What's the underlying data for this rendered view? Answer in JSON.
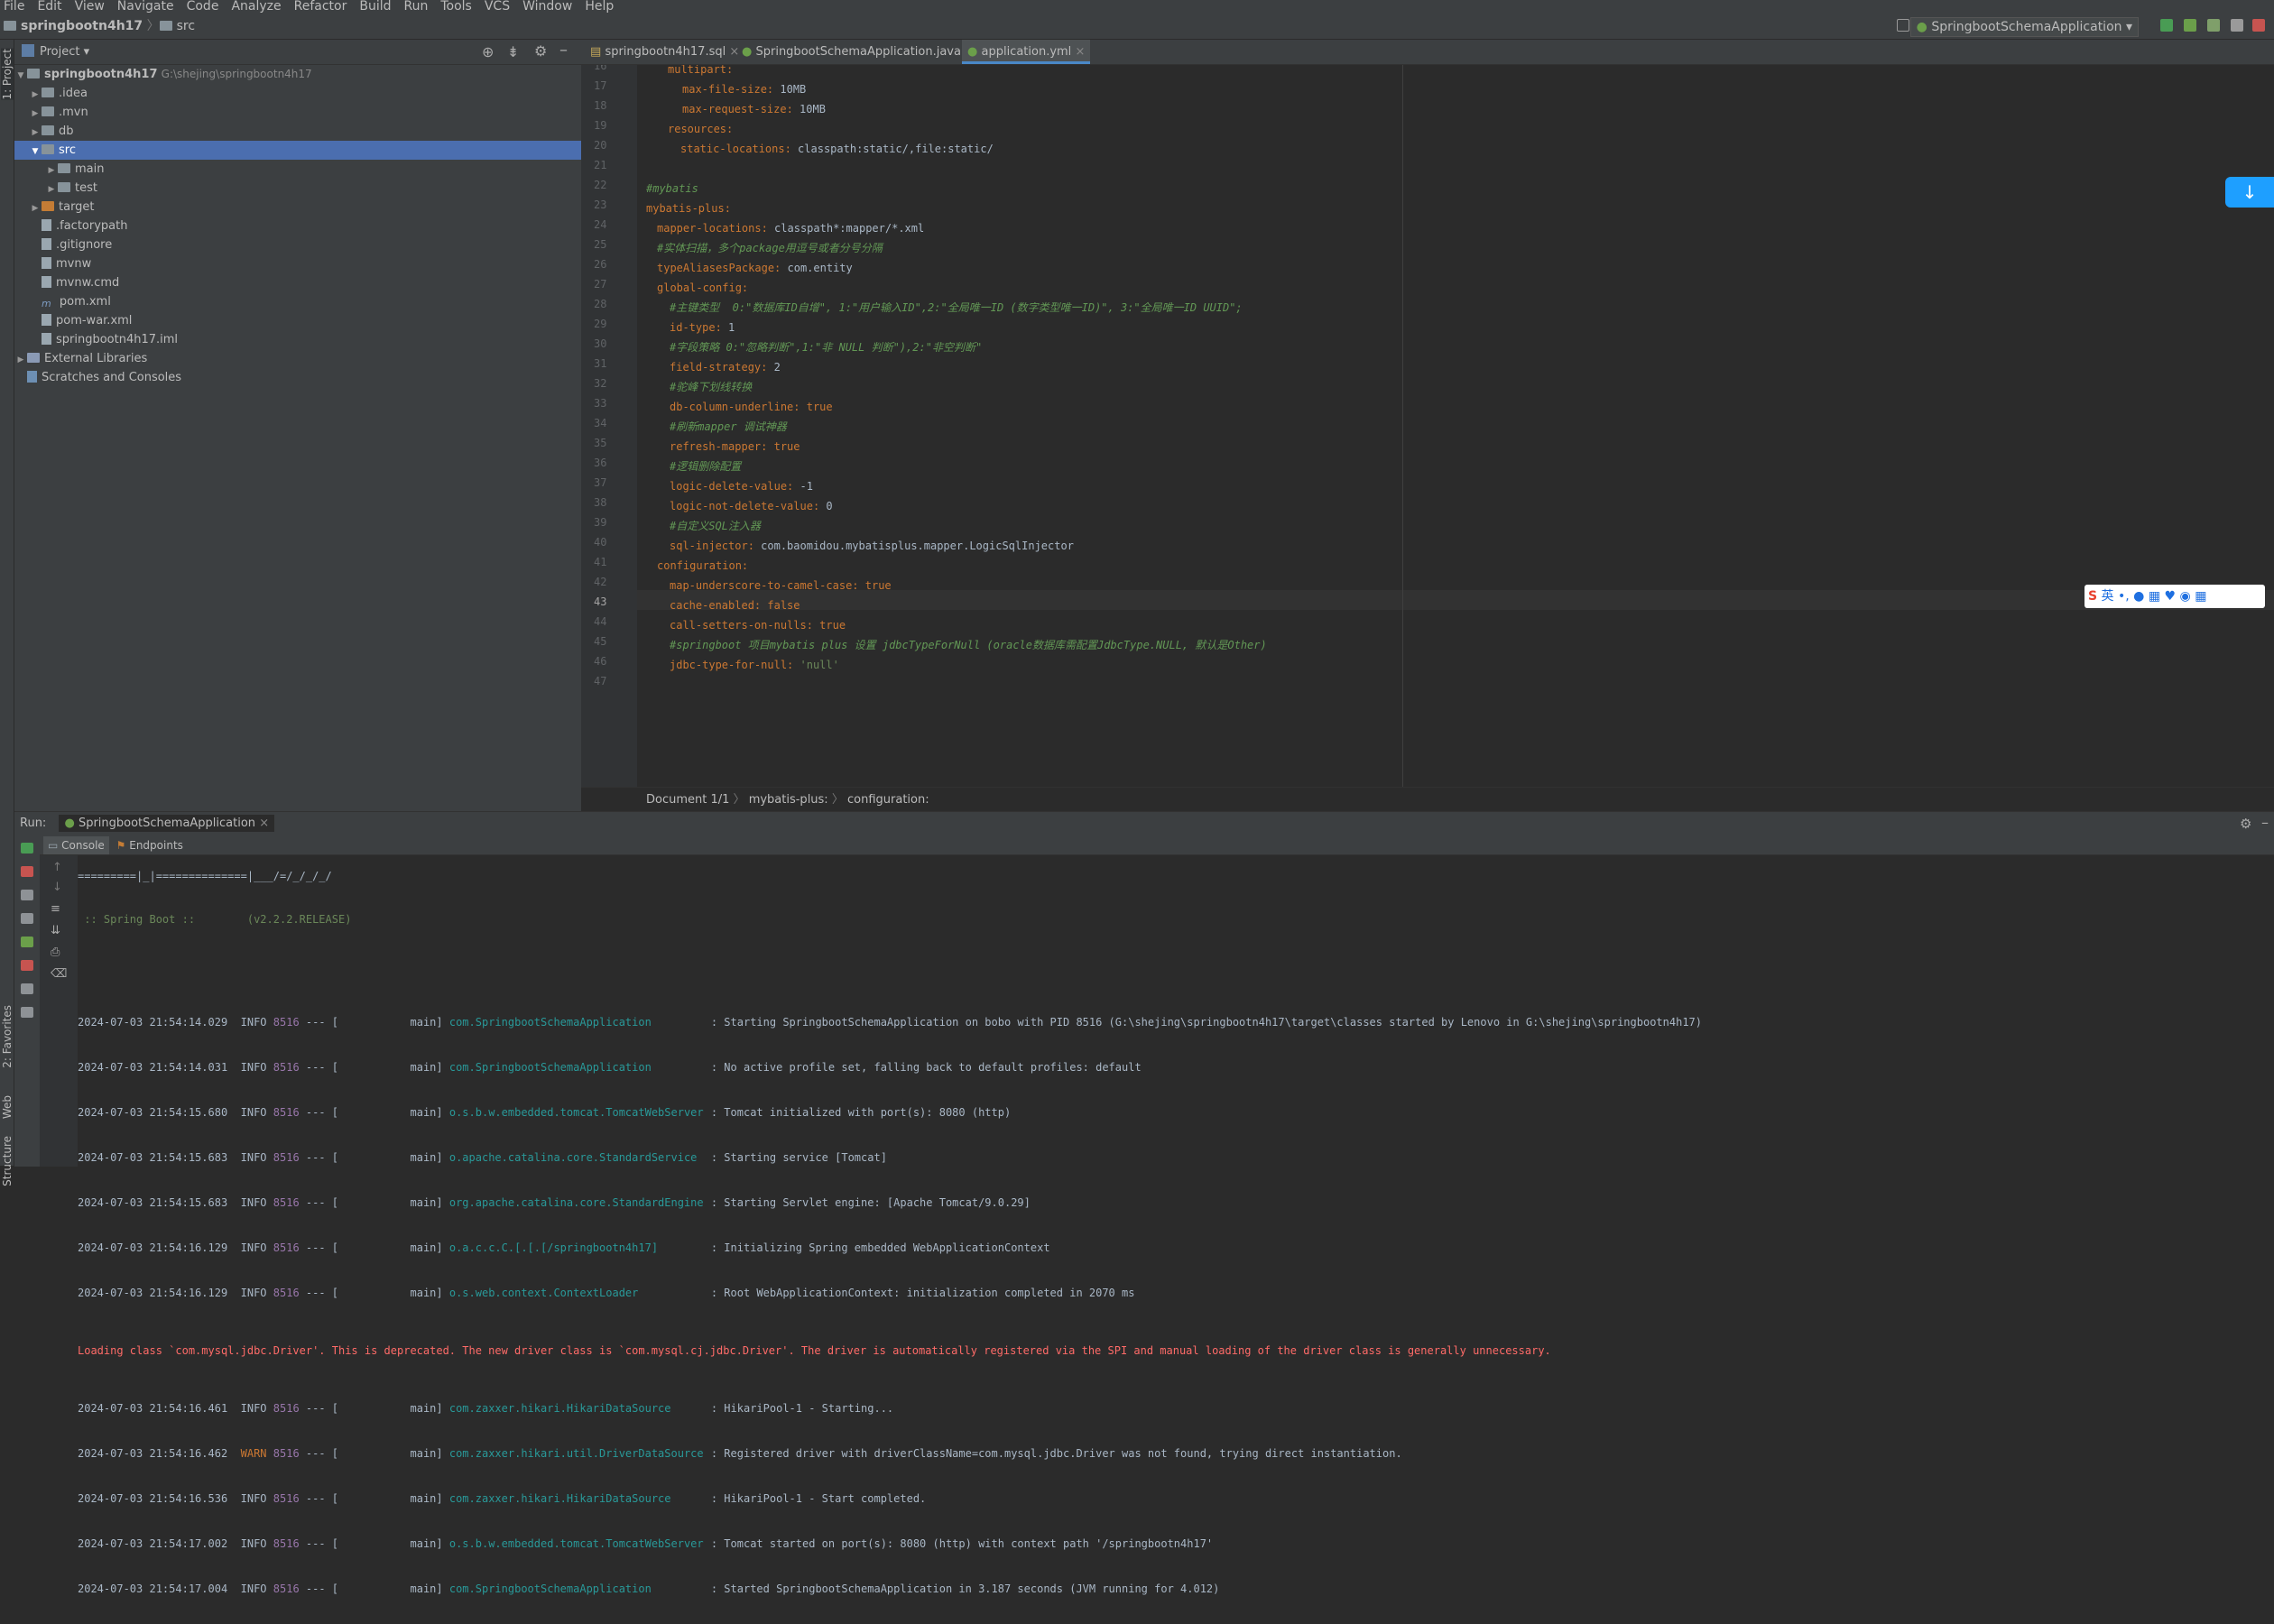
{
  "menubar": [
    "File",
    "Edit",
    "View",
    "Navigate",
    "Code",
    "Analyze",
    "Refactor",
    "Build",
    "Run",
    "Tools",
    "VCS",
    "Window",
    "Help"
  ],
  "breadcrumb": {
    "project": "springbootn4h17",
    "folder": "src"
  },
  "run_config": "SpringbootSchemaApplication",
  "left_tabs": {
    "project": "1: Project",
    "favorites": "2: Favorites",
    "web": "Web",
    "structure": "Structure"
  },
  "project_panel": {
    "title": "Project",
    "root": {
      "name": "springbootn4h17",
      "path": "G:\\shejing\\springbootn4h17"
    },
    "items": [
      ".idea",
      ".mvn",
      "db",
      "src",
      "main",
      "test",
      "target",
      ".factorypath",
      ".gitignore",
      "mvnw",
      "mvnw.cmd",
      "pom.xml",
      "pom-war.xml",
      "springbootn4h17.iml",
      "External Libraries",
      "Scratches and Consoles"
    ],
    "pom_prefix": "m"
  },
  "editor_tabs": [
    "springbootn4h17.sql",
    "SpringbootSchemaApplication.java",
    "application.yml"
  ],
  "code_lines": {
    "l16": {
      "n": "16",
      "k": "multipart:"
    },
    "l17": {
      "n": "17",
      "k": "max-file-size:",
      "v": " 10MB"
    },
    "l18": {
      "n": "18",
      "k": "max-request-size:",
      "v": " 10MB"
    },
    "l19": {
      "n": "19",
      "k": "resources:"
    },
    "l20": {
      "n": "20",
      "k": "static-locations:",
      "v": " classpath:static/,file:static/"
    },
    "l21": {
      "n": "21"
    },
    "l22": {
      "n": "22",
      "c": "#mybatis"
    },
    "l23": {
      "n": "23",
      "k": "mybatis-plus:"
    },
    "l24": {
      "n": "24",
      "k": "mapper-locations:",
      "v": " classpath*:mapper/*.xml"
    },
    "l25": {
      "n": "25",
      "c": "#实体扫描，多个package用逗号或者分号分隔"
    },
    "l26": {
      "n": "26",
      "k": "typeAliasesPackage:",
      "v": " com.entity"
    },
    "l27": {
      "n": "27",
      "k": "global-config:"
    },
    "l28": {
      "n": "28",
      "c": "#主键类型  0:\"数据库ID自增\", 1:\"用户输入ID\",2:\"全局唯一ID (数字类型唯一ID)\", 3:\"全局唯一ID UUID\";"
    },
    "l29": {
      "n": "29",
      "k": "id-type:",
      "v": " 1"
    },
    "l30": {
      "n": "30",
      "c": "#字段策略 0:\"忽略判断\",1:\"非 NULL 判断\"),2:\"非空判断\""
    },
    "l31": {
      "n": "31",
      "k": "field-strategy:",
      "v": " 2"
    },
    "l32": {
      "n": "32",
      "c": "#驼峰下划线转换"
    },
    "l33": {
      "n": "33",
      "k": "db-column-underline:",
      "v": " true",
      "vk": true
    },
    "l34": {
      "n": "34",
      "c": "#刷新mapper 调试神器"
    },
    "l35": {
      "n": "35",
      "k": "refresh-mapper:",
      "v": " true",
      "vk": true
    },
    "l36": {
      "n": "36",
      "c": "#逻辑删除配置"
    },
    "l37": {
      "n": "37",
      "k": "logic-delete-value:",
      "v": " -1"
    },
    "l38": {
      "n": "38",
      "k": "logic-not-delete-value:",
      "v": " 0"
    },
    "l39": {
      "n": "39",
      "c": "#自定义SQL注入器"
    },
    "l40": {
      "n": "40",
      "k": "sql-injector:",
      "v": " com.baomidou.mybatisplus.mapper.LogicSqlInjector"
    },
    "l41": {
      "n": "41",
      "k": "configuration:"
    },
    "l42": {
      "n": "42",
      "k": "map-underscore-to-camel-case:",
      "v": " true",
      "vk": true
    },
    "l43": {
      "n": "43",
      "k": "cache-enabled:",
      "v": " false",
      "vk": true
    },
    "l44": {
      "n": "44",
      "k": "call-setters-on-nulls:",
      "v": " true",
      "vk": true
    },
    "l45": {
      "n": "45",
      "c": "#springboot 项目mybatis plus 设置 jdbcTypeForNull (oracle数据库需配置JdbcType.NULL, 默认是Other)"
    },
    "l46": {
      "n": "46",
      "k": "jdbc-type-for-null:",
      "s": " 'null'"
    },
    "l47": {
      "n": "47"
    }
  },
  "editor_breadcrumb": {
    "doc": "Document 1/1",
    "a": "mybatis-plus:",
    "b": "configuration:"
  },
  "run_panel": {
    "label": "Run:",
    "tab": "SpringbootSchemaApplication",
    "console_tab": "Console",
    "endpoints_tab": "Endpoints"
  },
  "console": {
    "banner1": "=========|_|==============|___/=/_/_/_/",
    "banner2": " :: Spring Boot ::        (v2.2.2.RELEASE)",
    "rows": [
      {
        "ts": "2024-07-03 21:54:14.029",
        "lvl": "INFO",
        "pid": "8516",
        "th": "--- [           main]",
        "cls": "com.SpringbootSchemaApplication",
        "msg": ": Starting SpringbootSchemaApplication on bobo with PID 8516 (G:\\shejing\\springbootn4h17\\target\\classes started by Lenovo in G:\\shejing\\springbootn4h17)"
      },
      {
        "ts": "2024-07-03 21:54:14.031",
        "lvl": "INFO",
        "pid": "8516",
        "th": "--- [           main]",
        "cls": "com.SpringbootSchemaApplication",
        "msg": ": No active profile set, falling back to default profiles: default"
      },
      {
        "ts": "2024-07-03 21:54:15.680",
        "lvl": "INFO",
        "pid": "8516",
        "th": "--- [           main]",
        "cls": "o.s.b.w.embedded.tomcat.TomcatWebServer",
        "msg": ": Tomcat initialized with port(s): 8080 (http)"
      },
      {
        "ts": "2024-07-03 21:54:15.683",
        "lvl": "INFO",
        "pid": "8516",
        "th": "--- [           main]",
        "cls": "o.apache.catalina.core.StandardService",
        "msg": ": Starting service [Tomcat]"
      },
      {
        "ts": "2024-07-03 21:54:15.683",
        "lvl": "INFO",
        "pid": "8516",
        "th": "--- [           main]",
        "cls": "org.apache.catalina.core.StandardEngine",
        "msg": ": Starting Servlet engine: [Apache Tomcat/9.0.29]"
      },
      {
        "ts": "2024-07-03 21:54:16.129",
        "lvl": "INFO",
        "pid": "8516",
        "th": "--- [           main]",
        "cls": "o.a.c.c.C.[.[.[/springbootn4h17]",
        "msg": ": Initializing Spring embedded WebApplicationContext"
      },
      {
        "ts": "2024-07-03 21:54:16.129",
        "lvl": "INFO",
        "pid": "8516",
        "th": "--- [           main]",
        "cls": "o.s.web.context.ContextLoader",
        "msg": ": Root WebApplicationContext: initialization completed in 2070 ms"
      }
    ],
    "error": "Loading class `com.mysql.jdbc.Driver'. This is deprecated. The new driver class is `com.mysql.cj.jdbc.Driver'. The driver is automatically registered via the SPI and manual loading of the driver class is generally unnecessary.",
    "rows2": [
      {
        "ts": "2024-07-03 21:54:16.461",
        "lvl": "INFO",
        "pid": "8516",
        "th": "--- [           main]",
        "cls": "com.zaxxer.hikari.HikariDataSource",
        "msg": ": HikariPool-1 - Starting..."
      },
      {
        "ts": "2024-07-03 21:54:16.462",
        "lvl": "WARN",
        "pid": "8516",
        "th": "--- [           main]",
        "cls": "com.zaxxer.hikari.util.DriverDataSource",
        "msg": ": Registered driver with driverClassName=com.mysql.jdbc.Driver was not found, trying direct instantiation."
      },
      {
        "ts": "2024-07-03 21:54:16.536",
        "lvl": "INFO",
        "pid": "8516",
        "th": "--- [           main]",
        "cls": "com.zaxxer.hikari.HikariDataSource",
        "msg": ": HikariPool-1 - Start completed."
      },
      {
        "ts": "2024-07-03 21:54:17.002",
        "lvl": "INFO",
        "pid": "8516",
        "th": "--- [           main]",
        "cls": "o.s.b.w.embedded.tomcat.TomcatWebServer",
        "msg": ": Tomcat started on port(s): 8080 (http) with context path '/springbootn4h17'"
      },
      {
        "ts": "2024-07-03 21:54:17.004",
        "lvl": "INFO",
        "pid": "8516",
        "th": "--- [           main]",
        "cls": "com.SpringbootSchemaApplication",
        "msg": ": Started SpringbootSchemaApplication in 3.187 seconds (JVM running for 4.012)"
      }
    ]
  },
  "ime": {
    "brand": "S",
    "label": "英"
  },
  "scroll_down_glyph": "↓"
}
